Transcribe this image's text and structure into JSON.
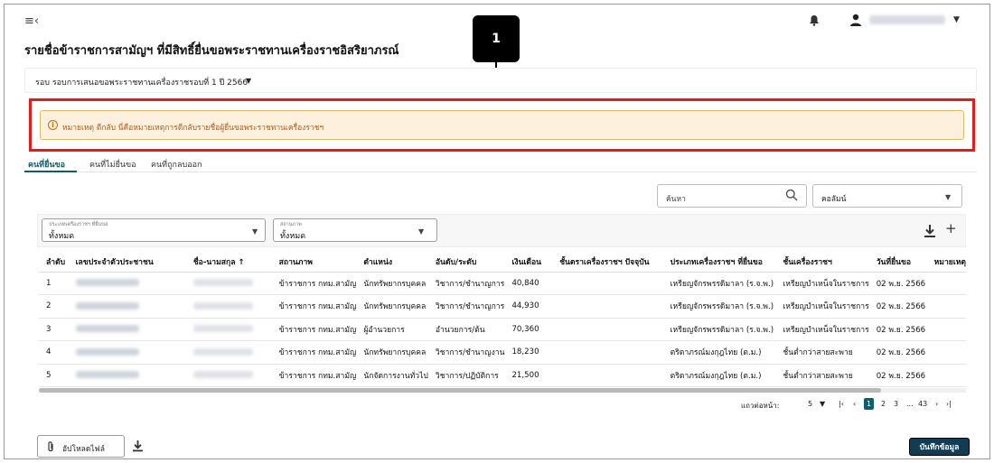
{
  "header": {
    "menu_icon": "menu-collapse-icon",
    "bell_icon": "bell-icon",
    "user_icon": "user-icon"
  },
  "page_title": "รายชื่อข้าราชการสามัญฯ ที่มีสิทธิ์ยื่นขอพระราชทานเครื่องราชอิสริยาภรณ์",
  "round": {
    "label": "รอบ  รอบการเสนอขอพระราชทานเครื่องราชรอบที่ 1 ปี 2566"
  },
  "callout": {
    "number": "1"
  },
  "note": {
    "text": "หมายเหตุ ตีกลับ นี่คือหมายเหตุการตีกลับรายชื่อผู้ยื่นขอพระราชทานเครื่องราชฯ",
    "accent": "#b8570b"
  },
  "tabs": [
    {
      "label": "คนที่ยื่นขอ",
      "active": true
    },
    {
      "label": "คนที่ไม่ยื่นขอ",
      "active": false
    },
    {
      "label": "คนที่ถูกลบออก",
      "active": false
    }
  ],
  "search": {
    "placeholder": "ค้นหา"
  },
  "column_select": {
    "value": "คอลัมน์"
  },
  "filters": [
    {
      "label": "ประเภทเครื่องราชฯ ที่ยื่นขอ",
      "value": "ทั้งหมด"
    },
    {
      "label": "สถานภาพ",
      "value": "ทั้งหมด"
    }
  ],
  "table": {
    "headers": [
      "ลำดับ",
      "เลขประจำตัวประชาชน",
      "ชื่อ-นามสกุล ↑",
      "สถานภาพ",
      "ตำแหน่ง",
      "อันดับ/ระดับ",
      "เงินเดือน",
      "ชั้นตราเครื่องราชฯ ปัจจุบัน",
      "ประเภทเครื่องราชฯ ที่ยื่นขอ",
      "ชั้นเครื่องราชฯ",
      "วันที่ยื่นขอ",
      "หมายเหตุ"
    ],
    "rows": [
      [
        "1",
        "",
        "",
        "ข้าราชการ กทม.สามัญ",
        "นักทรัพยากรบุคคล",
        "วิชาการ/ชำนาญการ",
        "40,840",
        "",
        "เหรียญจักรพรรดิมาลา (ร.จ.พ.)",
        "เหรียญบำเหน็จในราชการ",
        "02 พ.ย. 2566",
        ""
      ],
      [
        "2",
        "",
        "",
        "ข้าราชการ กทม.สามัญ",
        "นักทรัพยากรบุคคล",
        "วิชาการ/ชำนาญการ",
        "44,930",
        "",
        "เหรียญจักรพรรดิมาลา (ร.จ.พ.)",
        "เหรียญบำเหน็จในราชการ",
        "02 พ.ย. 2566",
        ""
      ],
      [
        "3",
        "",
        "",
        "ข้าราชการ กทม.สามัญ",
        "ผู้อำนวยการ",
        "อำนวยการ/ต้น",
        "70,360",
        "",
        "เหรียญจักรพรรดิมาลา (ร.จ.พ.)",
        "เหรียญบำเหน็จในราชการ",
        "02 พ.ย. 2566",
        ""
      ],
      [
        "4",
        "",
        "",
        "ข้าราชการ กทม.สามัญ",
        "นักทรัพยากรบุคคล",
        "วิชาการ/ชำนาญงาน",
        "18,230",
        "",
        "ตริตาภรณ์มงกุฎไทย (ต.ม.)",
        "ชั้นต่ำกว่าสายสะพาย",
        "02 พ.ย. 2566",
        ""
      ],
      [
        "5",
        "",
        "",
        "ข้าราชการ กทม.สามัญ",
        "นักจัดการงานทั่วไป",
        "วิชาการ/ปฏิบัติการ",
        "21,500",
        "",
        "ตริตาภรณ์มงกุฎไทย (ต.ม.)",
        "ชั้นต่ำกว่าสายสะพาย",
        "02 พ.ย. 2566",
        ""
      ]
    ]
  },
  "pagination": {
    "rows_per_page_label": "แถวต่อหน้า:",
    "rows_per_page": "5",
    "first": "|‹",
    "prev": "‹",
    "pages": [
      "1",
      "2",
      "3",
      "...",
      "43"
    ],
    "next": "›",
    "last": "›|"
  },
  "footer": {
    "upload_label": "อัปโหลดไฟล์",
    "save_label": "บันทึกข้อมูล"
  }
}
